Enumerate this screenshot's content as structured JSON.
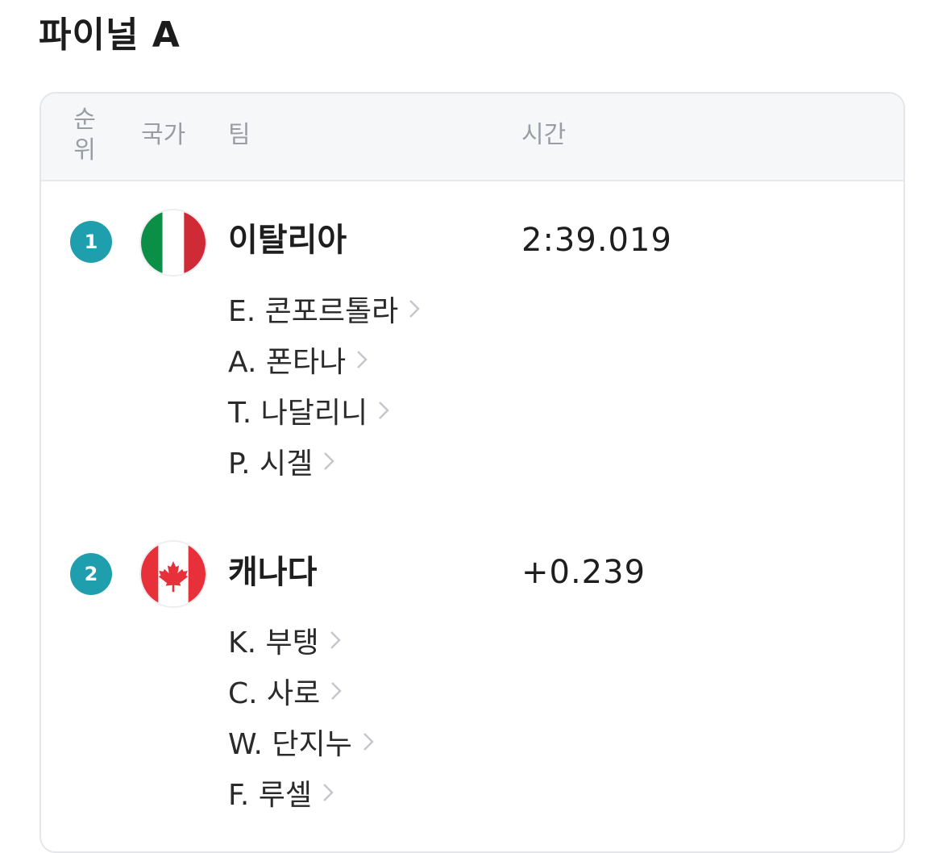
{
  "page": {
    "title": "파이널 A"
  },
  "table": {
    "headers": {
      "rank": "순\n위",
      "country": "국가",
      "team": "팀",
      "time": "시간"
    }
  },
  "results": [
    {
      "rank": "1",
      "flag_icon": "italy-flag-icon",
      "team": "이탈리아",
      "time": "2:39.019",
      "athletes": [
        "E. 콘포르톨라",
        "A. 폰타나",
        "T. 나달리니",
        "P. 시겔"
      ]
    },
    {
      "rank": "2",
      "flag_icon": "canada-flag-icon",
      "team": "캐나다",
      "time": "+0.239",
      "athletes": [
        "K. 부탱",
        "C. 사로",
        "W. 단지누",
        "F. 루셀"
      ]
    }
  ],
  "colors": {
    "rank_badge": "#1f9fae",
    "header_bg": "#f6f7f9",
    "border": "#e4e6ea"
  }
}
